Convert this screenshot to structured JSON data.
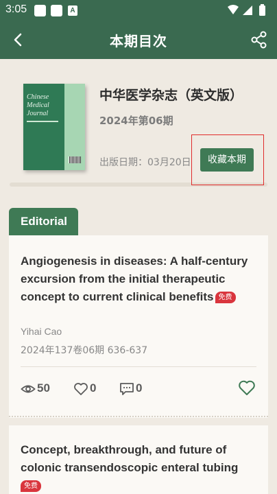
{
  "status_bar": {
    "time": "3:05",
    "notif_icon_letter": "A"
  },
  "app_bar": {
    "title": "本期目次"
  },
  "issue": {
    "journal_name": "中华医学杂志（英文版）",
    "issue_label": "2024年第06期",
    "publish_date": "出版日期：03月20日",
    "favorite_button": "收藏本期",
    "cover": {
      "title_lines": [
        "Chinese",
        "Medical",
        "Journal"
      ]
    }
  },
  "section": {
    "label": "Editorial"
  },
  "articles": [
    {
      "title": "Angiogenesis in diseases: A half-century excursion from the initial therapeutic concept to current clinical benefits",
      "badge": "免费",
      "author": "Yihai Cao",
      "source": "2024年137卷06期 636-637",
      "views": "50",
      "likes": "0",
      "comments": "0"
    },
    {
      "title": "Concept, breakthrough, and future of colonic transendoscopic enteral tubing",
      "badge": "免费"
    }
  ],
  "colors": {
    "primary": "#3a6a50",
    "button": "#3f7a55",
    "badge": "#d9353d",
    "highlight": "#e02a2a",
    "background": "#efeae2"
  }
}
